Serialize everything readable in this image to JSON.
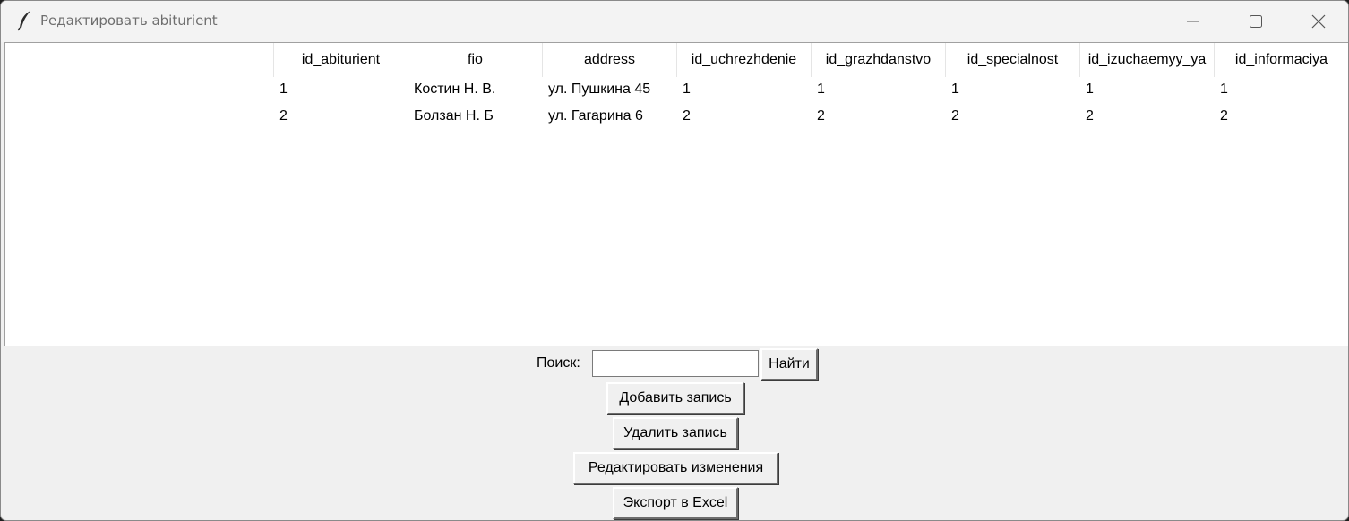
{
  "window": {
    "title": "Редактировать abiturient",
    "icon": "feather-icon"
  },
  "table": {
    "columns": [
      "id_abiturient",
      "fio",
      "address",
      "id_uchrezhdenie",
      "id_grazhdanstvo",
      "id_specialnost",
      "id_izuchaemyy_ya",
      "id_informaciya"
    ],
    "rows": [
      [
        "1",
        "Костин Н. В.",
        "ул. Пушкина 45",
        "1",
        "1",
        "1",
        "1",
        "1"
      ],
      [
        "2",
        "Болзан Н. Б",
        "ул. Гагарина 6",
        "2",
        "2",
        "2",
        "2",
        "2"
      ]
    ]
  },
  "search": {
    "label": "Поиск:",
    "value": "",
    "find_label": "Найти"
  },
  "actions": {
    "add_label": "Добавить запись",
    "delete_label": "Удалить запись",
    "edit_label": "Редактировать изменения",
    "export_label": "Экспорт в Excel"
  }
}
